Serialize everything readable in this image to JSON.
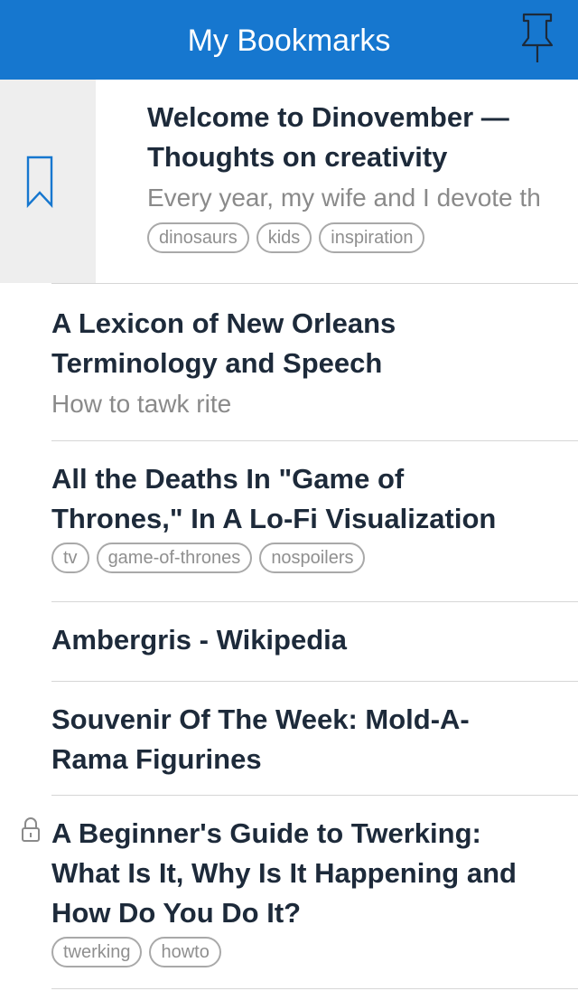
{
  "header": {
    "title": "My Bookmarks",
    "pin_icon": "pushpin-icon"
  },
  "colors": {
    "accent": "#1677cf",
    "title_text": "#1d2a3a",
    "secondary_text": "#8a8a8a",
    "swipe_background": "#eeeeee"
  },
  "bookmarks": [
    {
      "title_line1": "Welcome to Dinovember —",
      "title_line2": "Thoughts on creativity",
      "summary": "Every year, my wife and I devote th",
      "tags": [
        "dinosaurs",
        "kids",
        "inspiration"
      ],
      "swipe_action_icon": "bookmark-icon"
    },
    {
      "title_line1": "A Lexicon of New Orleans",
      "title_line2": "Terminology and Speech",
      "summary": "How to tawk rite",
      "tags": []
    },
    {
      "title_line1": "All the Deaths In \"Game of",
      "title_line2": "Thrones,\" In A Lo-Fi Visualization",
      "summary": "",
      "tags": [
        "tv",
        "game-of-thrones",
        "nospoilers"
      ]
    },
    {
      "title_line1": "Ambergris - Wikipedia",
      "summary": "",
      "tags": []
    },
    {
      "title_line1": "Souvenir Of The Week: Mold-A-",
      "title_line2": "Rama Figurines",
      "summary": "",
      "tags": []
    },
    {
      "title_line1": "A Beginner's Guide to Twerking:",
      "title_line2": "What Is It, Why Is It Happening and",
      "title_line3": "How Do You Do It?",
      "summary": "",
      "tags": [
        "twerking",
        "howto"
      ],
      "private_icon": "lock-icon"
    }
  ]
}
